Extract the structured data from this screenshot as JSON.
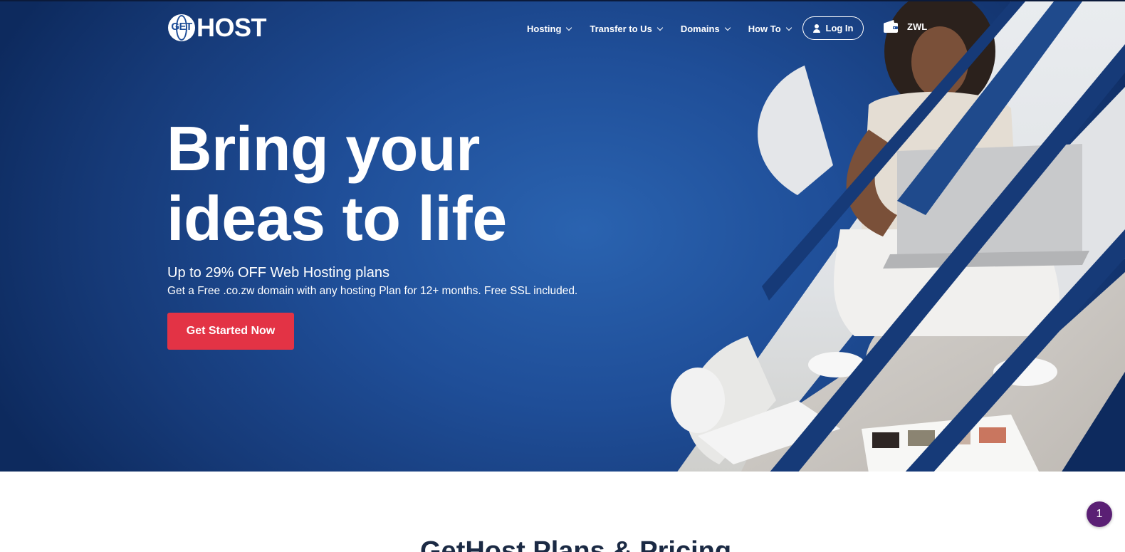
{
  "brand": {
    "logo_globe_text": "GET",
    "logo_text": "HOST"
  },
  "nav": {
    "items": [
      {
        "label": "Hosting"
      },
      {
        "label": "Transfer to Us"
      },
      {
        "label": "Domains"
      },
      {
        "label": "How To"
      }
    ],
    "login_label": "Log In",
    "currency_label": "ZWL"
  },
  "hero": {
    "title_line1": "Bring your",
    "title_line2": "ideas to life",
    "subtitle": "Up to 29% OFF Web Hosting plans",
    "description": "Get a Free .co.zw domain with any hosting Plan for 12+ months. Free SSL included.",
    "cta_label": "Get Started Now"
  },
  "section": {
    "title": "GetHost Plans & Pricing"
  },
  "notification_badge": "1",
  "colors": {
    "hero_blue": "#1f4e98",
    "cta_red": "#e33345",
    "badge_purple": "#5a1f74"
  }
}
